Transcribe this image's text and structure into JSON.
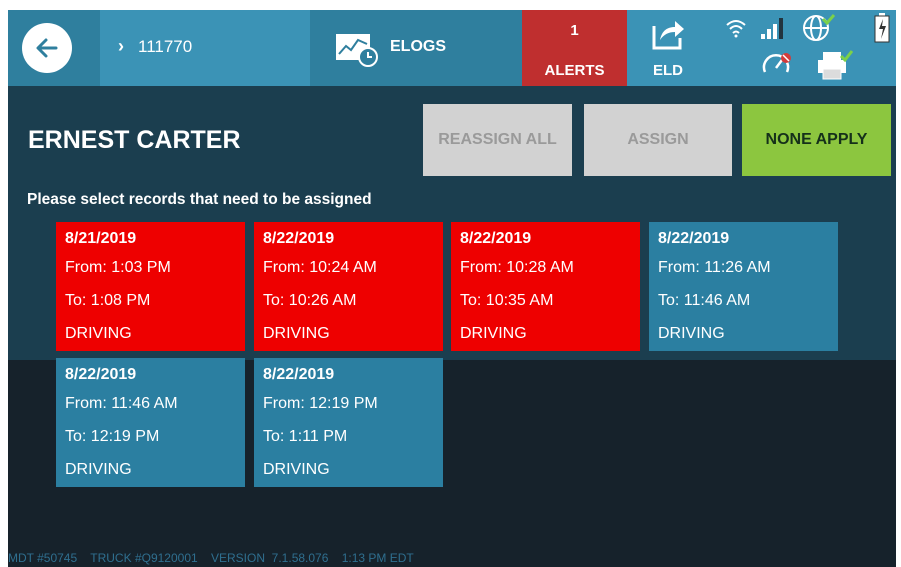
{
  "topbar": {
    "back_icon": "arrow-left-icon",
    "id_chevron": "›",
    "id_value": "111770",
    "elogs_icon": "chart-clock-icon",
    "elogs_label": "ELOGS",
    "alerts_count": "1",
    "alerts_label": "ALERTS",
    "eld_icon": "share-arrow-icon",
    "eld_label": "ELD",
    "status_icons": [
      "wifi-icon",
      "signal-bars-icon",
      "globe-check-icon",
      "battery-icon",
      "speedometer-icon",
      "printer-check-icon"
    ]
  },
  "driver": {
    "name": "ERNEST CARTER"
  },
  "actions": {
    "reassign_all": "REASSIGN ALL",
    "assign": "ASSIGN",
    "none_apply": "NONE APPLY"
  },
  "instruction": "Please select records that need to be assigned",
  "records": [
    {
      "date": "8/21/2019",
      "from": "From: 1:03 PM",
      "to": "To: 1:08 PM",
      "status": "DRIVING",
      "selected": true
    },
    {
      "date": "8/22/2019",
      "from": "From: 10:24 AM",
      "to": "To: 10:26 AM",
      "status": "DRIVING",
      "selected": true
    },
    {
      "date": "8/22/2019",
      "from": "From: 10:28 AM",
      "to": "To: 10:35 AM",
      "status": "DRIVING",
      "selected": true
    },
    {
      "date": "8/22/2019",
      "from": "From: 11:26 AM",
      "to": "To: 11:46 AM",
      "status": "DRIVING",
      "selected": false
    },
    {
      "date": "8/22/2019",
      "from": "From: 11:46 AM",
      "to": "To: 12:19 PM",
      "status": "DRIVING",
      "selected": false
    },
    {
      "date": "8/22/2019",
      "from": "From: 12:19 PM",
      "to": "To: 1:11 PM",
      "status": "DRIVING",
      "selected": false
    }
  ],
  "footer": "MDT #50745    TRUCK #Q9120001    VERSION  7.1.58.076    1:13 PM EDT",
  "colors": {
    "selected_record": "#ee0000",
    "unselected_record": "#2b7fa1",
    "none_apply": "#8cc63f",
    "alerts": "#bf2f2f"
  }
}
